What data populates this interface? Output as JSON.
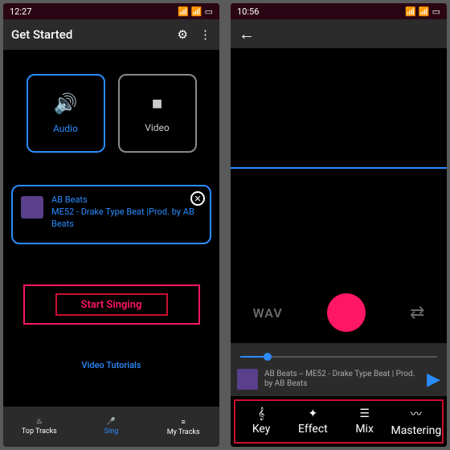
{
  "left": {
    "time": "12:27",
    "title": "Get Started",
    "modes": {
      "audio": "Audio",
      "video": "Video"
    },
    "track": {
      "artist": "AB Beats",
      "title": "ME52 - Drake Type Beat |Prod. by AB Beats"
    },
    "start": "Start Singing",
    "tutorials": "Video Tutorials",
    "nav": [
      "Top Tracks",
      "Sing",
      "My Tracks"
    ]
  },
  "right": {
    "time": "10:56",
    "wav": "WAV",
    "now_playing": "AB Beats -- ME52 - Drake Type Beat | Prod. by AB Beats",
    "tools": [
      "Key",
      "Effect",
      "Mix",
      "Mastering"
    ]
  }
}
